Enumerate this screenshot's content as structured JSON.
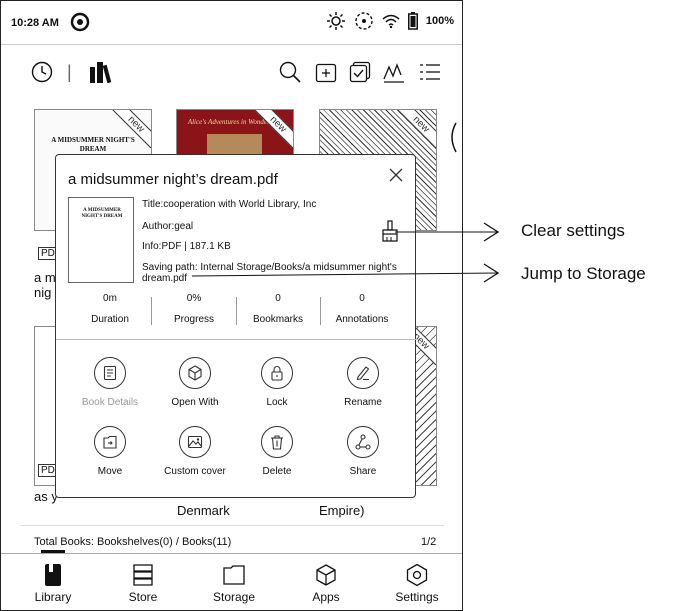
{
  "status": {
    "time": "10:28 AM",
    "battery": "100%"
  },
  "toolbar": {
    "separator": "|"
  },
  "shelf": {
    "badge": "new",
    "book1_cover": "A MIDSUMMER NIGHT'S DREAM",
    "book2_cover": "Alice's Adventures in Wonderland",
    "row1_left_format": "PD",
    "row1_left_title_a": "a m",
    "row1_left_title_b": "nig",
    "row2_left_format": "PD",
    "row2_left_title": "as y",
    "row2_mid_title": "Denmark",
    "row2_right_title": "Empire)"
  },
  "popup": {
    "title": "a midsummer night’s dream.pdf",
    "cover_text": "A MIDSUMMER NIGHT'S DREAM",
    "meta_title": "Title:cooperation with World Library, Inc",
    "meta_author": "Author:geal",
    "meta_info": "Info:PDF | 187.1 KB",
    "meta_path": "Saving path: Internal Storage/Books/a midsummer night's dream.pdf",
    "stats": [
      {
        "value": "0m",
        "label": "Duration"
      },
      {
        "value": "0%",
        "label": "Progress"
      },
      {
        "value": "0",
        "label": "Bookmarks"
      },
      {
        "value": "0",
        "label": "Annotations"
      }
    ],
    "actions": [
      {
        "label": "Book Details",
        "icon": "book-details-icon"
      },
      {
        "label": "Open With",
        "icon": "cube-icon"
      },
      {
        "label": "Lock",
        "icon": "lock-icon"
      },
      {
        "label": "Rename",
        "icon": "pen-icon"
      },
      {
        "label": "Move",
        "icon": "move-icon"
      },
      {
        "label": "Custom cover",
        "icon": "image-icon"
      },
      {
        "label": "Delete",
        "icon": "trash-icon"
      },
      {
        "label": "Share",
        "icon": "share-icon"
      }
    ]
  },
  "footer": {
    "total": "Total Books: Bookshelves(0) / Books(11)",
    "page": "1/2"
  },
  "nav": [
    {
      "label": "Library",
      "icon": "library-icon",
      "active": true
    },
    {
      "label": "Store",
      "icon": "store-icon"
    },
    {
      "label": "Storage",
      "icon": "folder-icon"
    },
    {
      "label": "Apps",
      "icon": "apps-icon"
    },
    {
      "label": "Settings",
      "icon": "settings-icon"
    }
  ],
  "callouts": {
    "clear_settings": "Clear settings",
    "jump_to_storage": "Jump to Storage"
  }
}
